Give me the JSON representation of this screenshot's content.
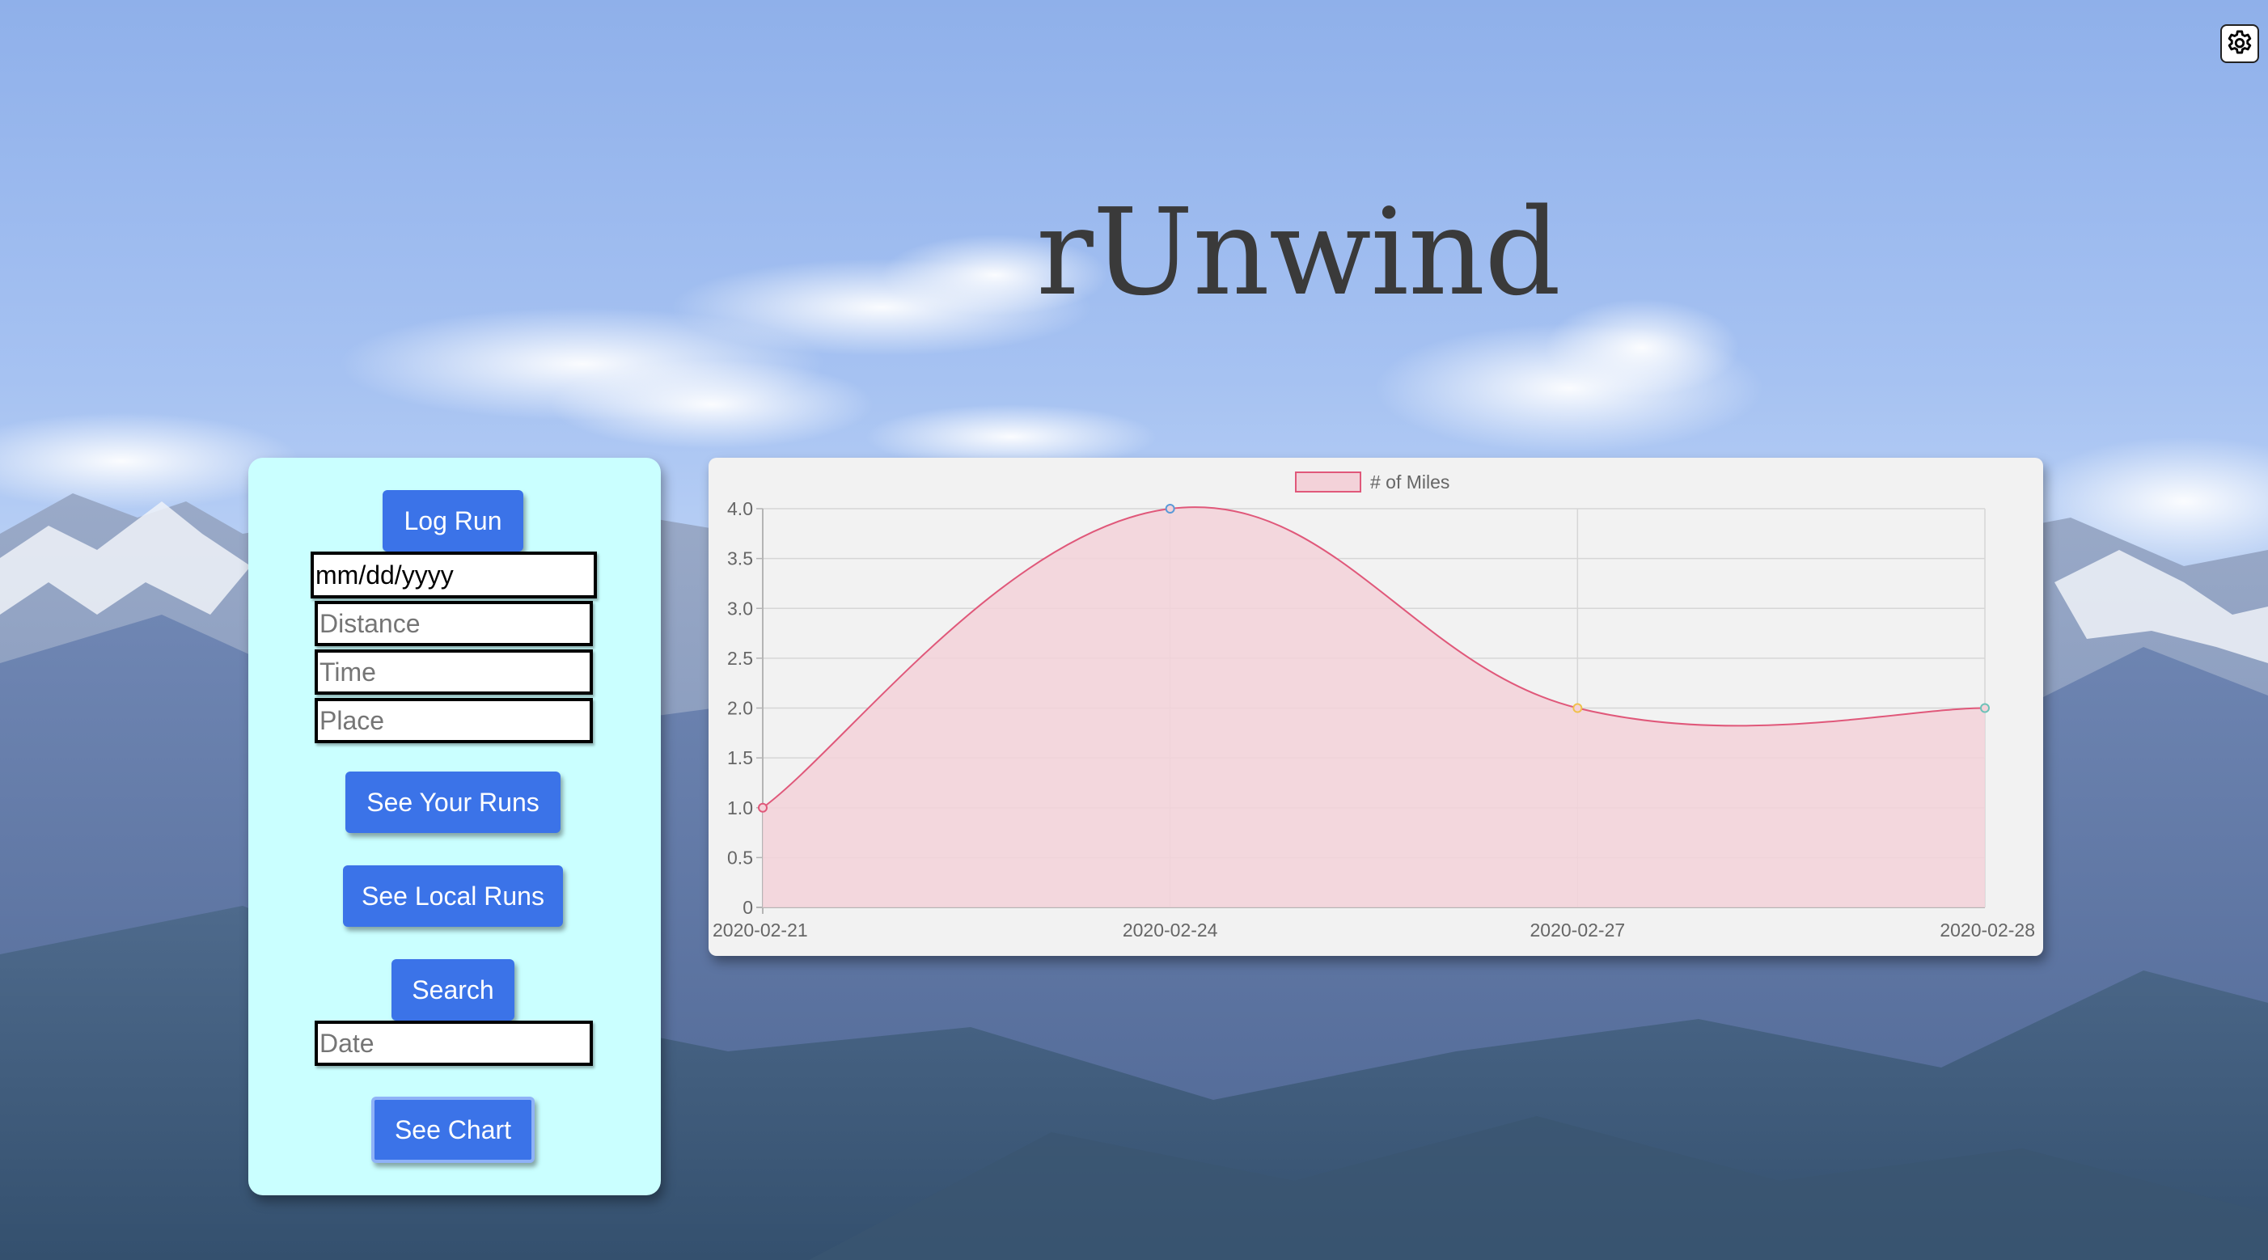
{
  "app": {
    "title": "rUnwind"
  },
  "settings": {
    "icon": "gear-icon"
  },
  "panel": {
    "log_run_label": "Log Run",
    "date_input": {
      "value": "mm/dd/yyyy"
    },
    "distance_input": {
      "placeholder": "Distance"
    },
    "time_input": {
      "placeholder": "Time"
    },
    "place_input": {
      "placeholder": "Place"
    },
    "see_your_runs_label": "See Your Runs",
    "see_local_runs_label": "See Local Runs",
    "search_label": "Search",
    "search_date_input": {
      "placeholder": "Date"
    },
    "see_chart_label": "See Chart"
  },
  "colors": {
    "button": "#3b73e8",
    "panel": "#caffff",
    "series_line": "#e0587a",
    "series_fill": "#f3d2d9"
  },
  "chart_data": {
    "type": "line",
    "x": [
      "2020-02-21",
      "2020-02-24",
      "2020-02-27",
      "2020-02-28"
    ],
    "series": [
      {
        "name": "# of Miles",
        "values": [
          1,
          4,
          2,
          2
        ]
      }
    ],
    "point_colors": [
      "#e0587a",
      "#5a9ad8",
      "#f0c14b",
      "#6cc2b8"
    ],
    "ylim": [
      0,
      4
    ],
    "yticks": [
      "0",
      "0.5",
      "1.0",
      "1.5",
      "2.0",
      "2.5",
      "3.0",
      "3.5",
      "4.0"
    ],
    "ytick_values": [
      0,
      0.5,
      1,
      1.5,
      2,
      2.5,
      3,
      3.5,
      4
    ],
    "grid": true,
    "fill": true,
    "smooth": true,
    "legend": "top-center"
  }
}
